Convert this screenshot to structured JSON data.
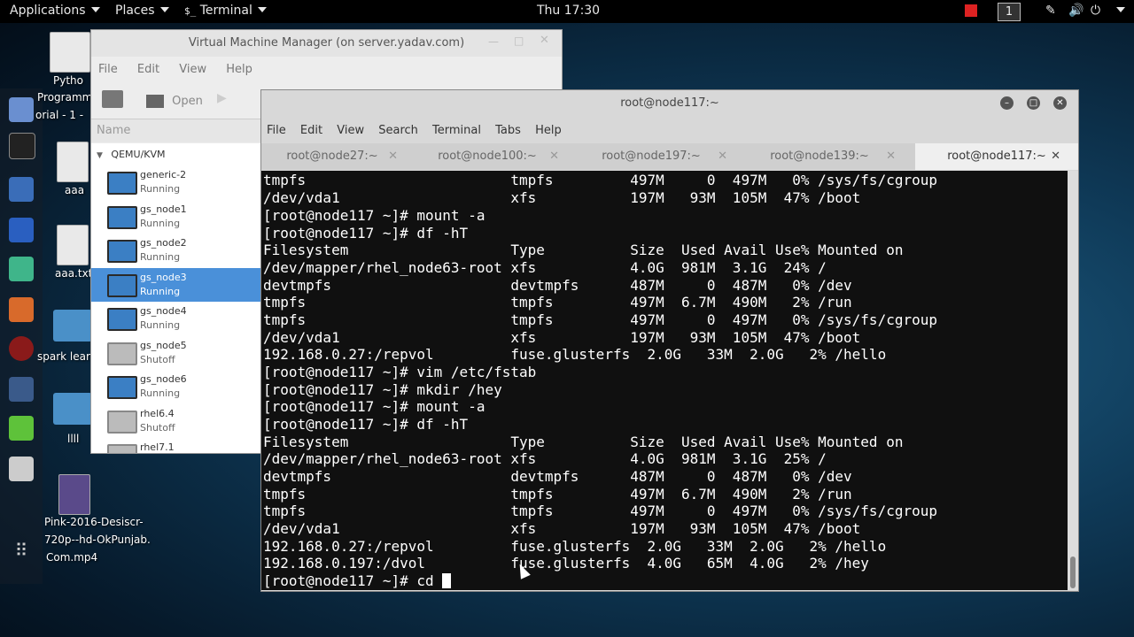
{
  "topbar": {
    "applications": "Applications",
    "places": "Places",
    "terminal": "Terminal",
    "clock": "Thu 17:30",
    "workspace": "1"
  },
  "desktop": {
    "icons": [
      "Pytho",
      "Programm",
      "orial - 1 -",
      "aaa",
      "aaa.txt",
      "spark lear",
      "llll",
      "Pink-2016-Desiscr-",
      "720p--hd-OkPunjab.",
      "Com.mp4"
    ]
  },
  "vmm": {
    "title": "Virtual Machine Manager (on server.yadav.com)",
    "menu": [
      "File",
      "Edit",
      "View",
      "Help"
    ],
    "toolbar_open": "Open",
    "list_header": "Name",
    "group": "QEMU/KVM",
    "vms": [
      {
        "name": "generic-2",
        "status": "Running"
      },
      {
        "name": "gs_node1",
        "status": "Running"
      },
      {
        "name": "gs_node2",
        "status": "Running"
      },
      {
        "name": "gs_node3",
        "status": "Running"
      },
      {
        "name": "gs_node4",
        "status": "Running"
      },
      {
        "name": "gs_node5",
        "status": "Shutoff"
      },
      {
        "name": "gs_node6",
        "status": "Running"
      },
      {
        "name": "rhel6.4",
        "status": "Shutoff"
      },
      {
        "name": "rhel7.1",
        "status": ""
      }
    ]
  },
  "terminal": {
    "title": "root@node117:~",
    "menu": [
      "File",
      "Edit",
      "View",
      "Search",
      "Terminal",
      "Tabs",
      "Help"
    ],
    "tabs": [
      "root@node27:~",
      "root@node100:~",
      "root@node197:~",
      "root@node139:~",
      "root@node117:~"
    ],
    "lines": [
      "tmpfs                        tmpfs         497M     0  497M   0% /sys/fs/cgroup",
      "/dev/vda1                    xfs           197M   93M  105M  47% /boot",
      "[root@node117 ~]# mount -a",
      "[root@node117 ~]# df -hT",
      "Filesystem                   Type          Size  Used Avail Use% Mounted on",
      "/dev/mapper/rhel_node63-root xfs           4.0G  981M  3.1G  24% /",
      "devtmpfs                     devtmpfs      487M     0  487M   0% /dev",
      "tmpfs                        tmpfs         497M  6.7M  490M   2% /run",
      "tmpfs                        tmpfs         497M     0  497M   0% /sys/fs/cgroup",
      "/dev/vda1                    xfs           197M   93M  105M  47% /boot",
      "192.168.0.27:/repvol         fuse.glusterfs  2.0G   33M  2.0G   2% /hello",
      "[root@node117 ~]# vim /etc/fstab",
      "[root@node117 ~]# mkdir /hey",
      "[root@node117 ~]# mount -a",
      "[root@node117 ~]# df -hT",
      "Filesystem                   Type          Size  Used Avail Use% Mounted on",
      "/dev/mapper/rhel_node63-root xfs           4.0G  981M  3.1G  25% /",
      "devtmpfs                     devtmpfs      487M     0  487M   0% /dev",
      "tmpfs                        tmpfs         497M  6.7M  490M   2% /run",
      "tmpfs                        tmpfs         497M     0  497M   0% /sys/fs/cgroup",
      "/dev/vda1                    xfs           197M   93M  105M  47% /boot",
      "192.168.0.27:/repvol         fuse.glusterfs  2.0G   33M  2.0G   2% /hello",
      "192.168.0.197:/dvol          fuse.glusterfs  4.0G   65M  4.0G   2% /hey",
      "[root@node117 ~]# cd "
    ]
  },
  "colors": {
    "accent": "#4a90d9",
    "terminal_bg": "#000000"
  }
}
